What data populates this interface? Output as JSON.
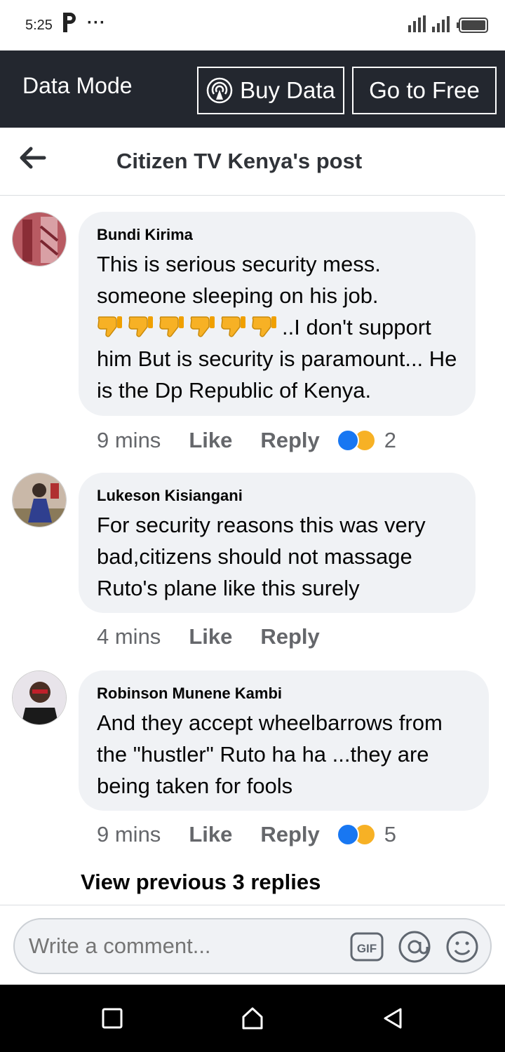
{
  "status_bar": {
    "time": "5:25",
    "app_icon": "p-icon",
    "more": "···"
  },
  "data_bar": {
    "mode_label": "Data Mode",
    "buy_label": "Buy Data",
    "free_label": "Go to Free"
  },
  "header": {
    "title": "Citizen TV Kenya's post"
  },
  "comments": [
    {
      "author": "Bundi Kirima",
      "text_line1": "This is serious security mess. someone sleeping on his job.",
      "thumbs_down_count": 6,
      "text_line2": "..I don't  support him But is security is paramount... He is the Dp Republic of Kenya.",
      "time": "9 mins",
      "like": "Like",
      "reply": "Reply",
      "reaction_count": "2"
    },
    {
      "author": "Lukeson Kisiangani",
      "text": "For security reasons this was very bad,citizens should not massage Ruto's plane like this surely",
      "time": "4 mins",
      "like": "Like",
      "reply": "Reply"
    },
    {
      "author": "Robinson Munene Kambi",
      "text": "And they accept wheelbarrows from the \"hustler\" Ruto ha ha ...they are being taken for fools",
      "time": "9 mins",
      "like": "Like",
      "reply": "Reply",
      "reaction_count": "5"
    }
  ],
  "view_previous": "View previous 3 replies",
  "composer": {
    "placeholder": "Write a comment...",
    "gif": "GIF"
  },
  "colors": {
    "data_bar_bg": "#23272f",
    "bubble_bg": "#f0f2f5",
    "like_blue": "#1877f2",
    "haha_yellow": "#f7b125"
  }
}
